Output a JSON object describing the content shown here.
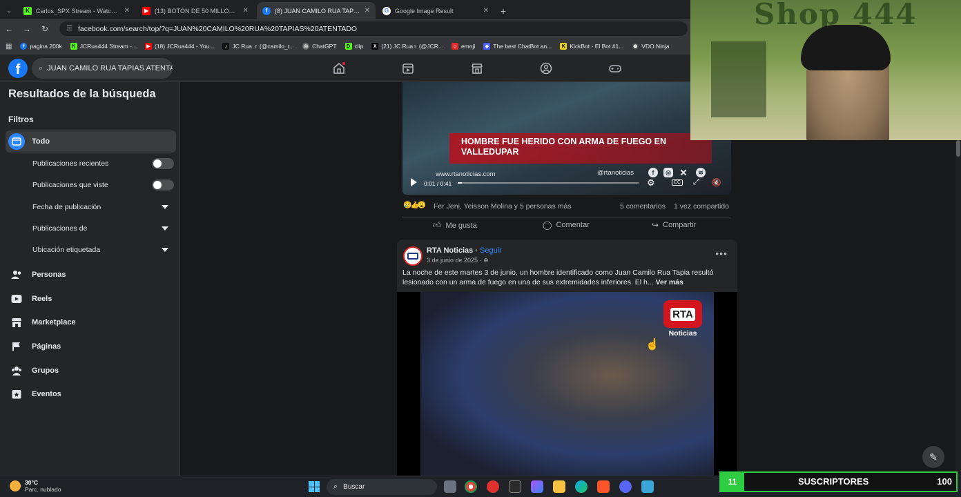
{
  "browser": {
    "tabs": [
      {
        "title": "Carlos_SPX Stream - Watch Live",
        "icon": "kick-icon",
        "color": "#53fc18",
        "active": false
      },
      {
        "title": "(13) BOTÓN DE 50 MILLONES",
        "icon": "youtube-icon",
        "color": "#ff0000",
        "active": false
      },
      {
        "title": "(8) JUAN CAMILO RUA TAPIAS",
        "icon": "facebook-icon",
        "color": "#1877f2",
        "active": true
      },
      {
        "title": "Google Image Result",
        "icon": "google-icon",
        "color": "#ffffff",
        "active": false
      }
    ],
    "url": "facebook.com/search/top/?q=JUAN%20CAMILO%20RUA%20TAPIAS%20ATENTADO",
    "bookmarks": [
      {
        "label": "pagina 200k",
        "color": "#1877f2"
      },
      {
        "label": "JCRua444 Stream -...",
        "color": "#53fc18"
      },
      {
        "label": "(18) JCRua444 - You...",
        "color": "#ff0000"
      },
      {
        "label": "JC Rua ♀ (@camilo_r...",
        "color": "#111111"
      },
      {
        "label": "ChatGPT",
        "color": "#6b6b6b"
      },
      {
        "label": "clip",
        "color": "#53fc18"
      },
      {
        "label": "(21) JC Rua♀ (@JCR...",
        "color": "#000000"
      },
      {
        "label": "emoji",
        "color": "#e02b2b"
      },
      {
        "label": "The best ChatBot an...",
        "color": "#4a5cff"
      },
      {
        "label": "KickBot - El Bot #1...",
        "color": "#e6d21c"
      },
      {
        "label": "VDO.Ninja",
        "color": "#444444"
      }
    ]
  },
  "facebook": {
    "search_value": "JUAN CAMILO RUA TAPIAS ATENTA",
    "sidebar": {
      "title": "Resultados de la búsqueda",
      "filters_label": "Filtros",
      "all_label": "Todo",
      "sub_filters": [
        {
          "label": "Publicaciones recientes",
          "control": "toggle"
        },
        {
          "label": "Publicaciones que viste",
          "control": "toggle"
        },
        {
          "label": "Fecha de publicación",
          "control": "dropdown"
        },
        {
          "label": "Publicaciones de",
          "control": "dropdown"
        },
        {
          "label": "Ubicación etiquetada",
          "control": "dropdown"
        }
      ],
      "categories": [
        "Personas",
        "Reels",
        "Marketplace",
        "Páginas",
        "Grupos",
        "Eventos"
      ]
    },
    "post1": {
      "banner": "HOMBRE FUE HERIDO CON ARMA DE FUEGO EN VALLEDUPAR",
      "video_url_text": "www.rtanoticias.com",
      "video_handle": "@rtanoticias",
      "time": "0:01 / 0:41",
      "progress": 0.024,
      "reactions_text": "Fer Jeni, Yeisson Molina y 5 personas más",
      "comments": "5 comentarios",
      "shares": "1 vez compartido",
      "like_label": "Me gusta",
      "comment_label": "Comentar",
      "share_label": "Compartir"
    },
    "post2": {
      "author": "RTA Noticias",
      "follow": "Seguir",
      "date": "3 de junio de 2025 ·",
      "text": "La noche de este martes 3 de junio, un hombre identificado como Juan Camilo Rua Tapia resultó lesionado con un arma de fuego en una de sus extremidades inferiores. El h...",
      "see_more": "Ver más",
      "logo_text": "RTA",
      "logo_sub": "Noticias"
    }
  },
  "webcam": {
    "sign_text": "Shop 444"
  },
  "taskbar": {
    "temp": "30°C",
    "weather": "Parc. nublado",
    "search_label": "Buscar"
  },
  "overlay": {
    "subs_count": "11",
    "subs_label": "SUSCRIPTORES",
    "subs_goal": "100"
  }
}
